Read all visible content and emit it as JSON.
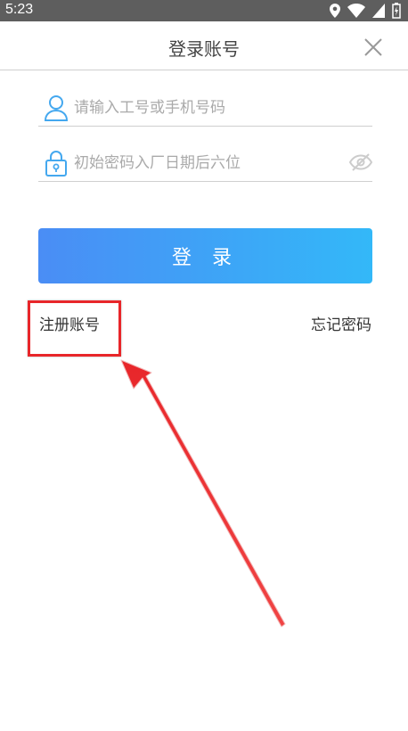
{
  "status_bar": {
    "time": "5:23"
  },
  "header": {
    "title": "登录账号"
  },
  "form": {
    "account_placeholder": "请输入工号或手机号码",
    "password_placeholder": "初始密码入厂日期后六位",
    "login_label": "登 录"
  },
  "links": {
    "register": "注册账号",
    "forgot": "忘记密码"
  },
  "colors": {
    "accent_start": "#4a8df5",
    "accent_end": "#33b8f8",
    "annotation": "#e8262a"
  }
}
